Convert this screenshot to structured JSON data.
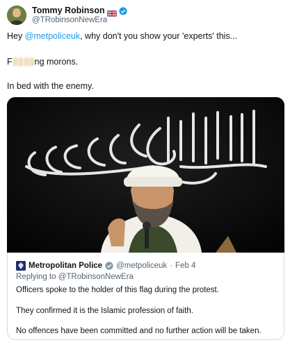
{
  "author": {
    "name": "Tommy Robinson",
    "handle": "@TRobinsonNewEra",
    "flag_icon": "uk-flag-icon",
    "verified_icon": "verified-badge-icon"
  },
  "tweet": {
    "line1": {
      "prefix": "Hey ",
      "mention": "@metpoliceuk",
      "suffix": ", why don't you show your 'experts' this..."
    },
    "line2": {
      "start": "F",
      "end": "ng morons."
    },
    "line3": "In bed with the enemy.",
    "media_icon": "flag-photo-image"
  },
  "quote": {
    "name": "Metropolitan Police",
    "handle": "@metpoliceuk",
    "separator": "·",
    "date": "Feb 4",
    "replying_to": "Replying to @TRobinsonNewEra",
    "lines": [
      "Officers spoke to the holder of this flag during the protest.",
      "They confirmed it is the Islamic profession of faith.",
      "No offences have been committed and no further action will be taken."
    ],
    "logo_icon": "met-police-logo-icon"
  },
  "colors": {
    "link": "#1d9bf0",
    "text": "#0f1419",
    "muted": "#536471",
    "border": "#cfd9de",
    "verified": "#1d9bf0",
    "gov_badge": "#829aab"
  }
}
